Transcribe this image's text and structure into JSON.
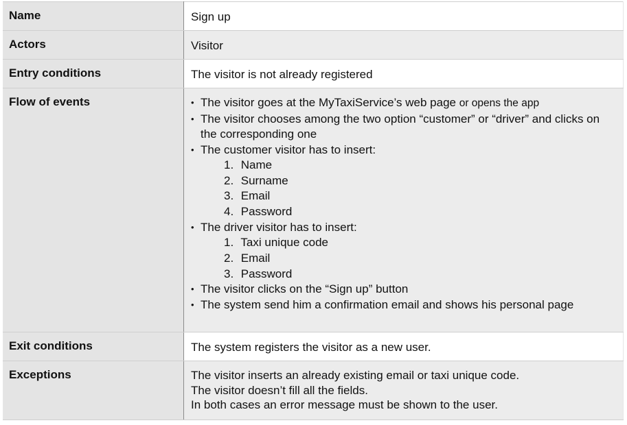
{
  "rows": {
    "name": {
      "label": "Name",
      "value": "Sign up"
    },
    "actors": {
      "label": "Actors",
      "value": "Visitor"
    },
    "entry": {
      "label": "Entry conditions",
      "value": "The visitor is not already registered"
    },
    "flow": {
      "label": "Flow of events",
      "step1": "The visitor goes at the MyTaxiService’s web page",
      "step1_tail": "or opens the app",
      "step2": "The visitor chooses among the two option “customer” or “driver” and clicks on the corresponding one",
      "step3": "The customer visitor has to insert:",
      "customer_fields": [
        "Name",
        "Surname",
        "Email",
        "Password"
      ],
      "step4": "The driver visitor has to insert:",
      "driver_fields": [
        "Taxi unique code",
        "Email",
        "Password"
      ],
      "step5": "The visitor clicks on the “Sign up” button",
      "step6": "The system send him a confirmation email and shows his personal page"
    },
    "exit": {
      "label": "Exit conditions",
      "value": "The system registers the visitor as a new user."
    },
    "exceptions": {
      "label": "Exceptions",
      "lines": [
        "The visitor inserts an already existing email or taxi unique code.",
        "The visitor doesn’t fill all the fields.",
        "In both cases an error message must be shown to the user."
      ]
    }
  },
  "markers": {
    "bullet": "•",
    "customer_numbers": [
      "1.",
      "2.",
      "3.",
      "4."
    ],
    "driver_numbers": [
      "1.",
      "2.",
      "3."
    ]
  }
}
